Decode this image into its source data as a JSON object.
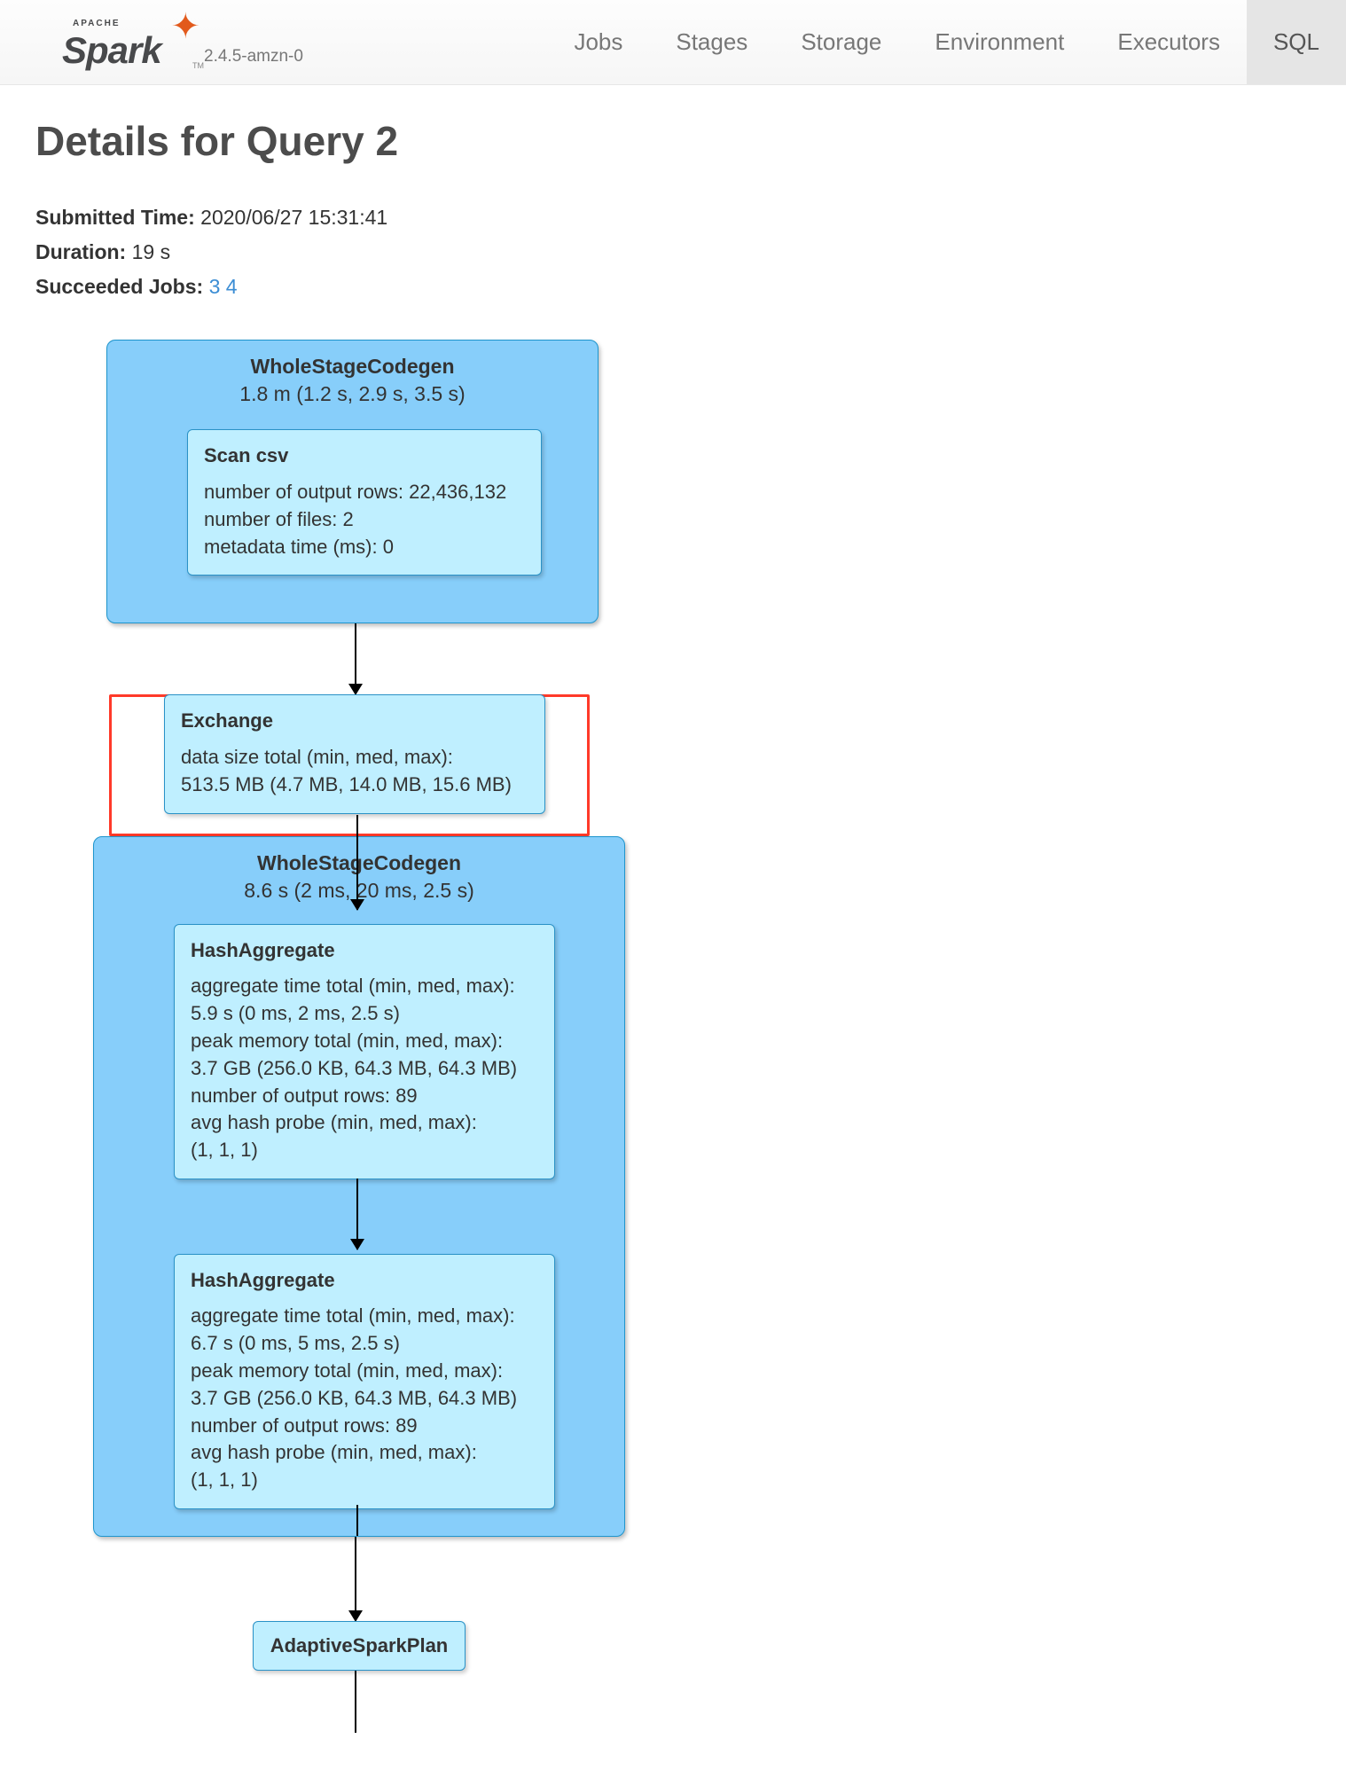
{
  "brand": {
    "apache": "APACHE",
    "name": "Spark",
    "tm": "TM",
    "version": "2.4.5-amzn-0"
  },
  "nav": {
    "jobs": "Jobs",
    "stages": "Stages",
    "storage": "Storage",
    "environment": "Environment",
    "executors": "Executors",
    "sql": "SQL"
  },
  "page": {
    "title": "Details for Query 2",
    "submitted_label": "Submitted Time:",
    "submitted_value": "2020/06/27 15:31:41",
    "duration_label": "Duration:",
    "duration_value": "19 s",
    "succeeded_label": "Succeeded Jobs:",
    "job_links": {
      "a": "3",
      "b": "4"
    }
  },
  "plan": {
    "w1": {
      "title": "WholeStageCodegen",
      "time": "1.8 m (1.2 s, 2.9 s, 3.5 s)",
      "scan": {
        "title": "Scan csv",
        "rows": "number of output rows: 22,436,132",
        "files": "number of files: 2",
        "meta": "metadata time (ms): 0"
      }
    },
    "exchange": {
      "title": "Exchange",
      "l1": "data size total (min, med, max):",
      "l2": "513.5 MB (4.7 MB, 14.0 MB, 15.6 MB)"
    },
    "w2": {
      "title": "WholeStageCodegen",
      "time": "8.6 s (2 ms, 20 ms, 2.5 s)",
      "ha1": {
        "title": "HashAggregate",
        "l1": "aggregate time total (min, med, max):",
        "l2": "5.9 s (0 ms, 2 ms, 2.5 s)",
        "l3": "peak memory total (min, med, max):",
        "l4": "3.7 GB (256.0 KB, 64.3 MB, 64.3 MB)",
        "l5": "number of output rows: 89",
        "l6": "avg hash probe (min, med, max):",
        "l7": "(1, 1, 1)"
      },
      "ha2": {
        "title": "HashAggregate",
        "l1": "aggregate time total (min, med, max):",
        "l2": "6.7 s (0 ms, 5 ms, 2.5 s)",
        "l3": "peak memory total (min, med, max):",
        "l4": "3.7 GB (256.0 KB, 64.3 MB, 64.3 MB)",
        "l5": "number of output rows: 89",
        "l6": "avg hash probe (min, med, max):",
        "l7": "(1, 1, 1)"
      }
    },
    "adaptive": {
      "title": "AdaptiveSparkPlan"
    }
  }
}
